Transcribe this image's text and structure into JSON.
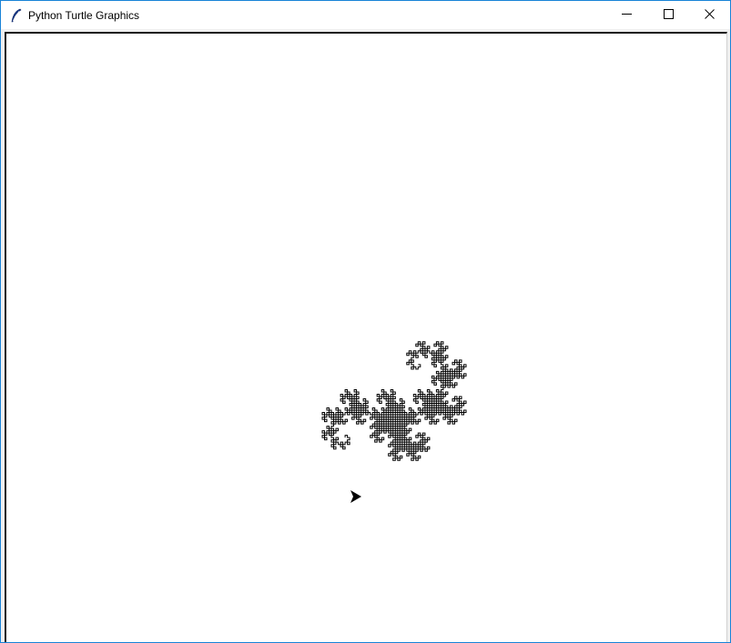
{
  "window": {
    "title": "Python Turtle Graphics",
    "icon": "feather-icon",
    "controls": {
      "minimize": "minimize-icon",
      "maximize": "maximize-icon",
      "close": "close-icon"
    }
  },
  "canvas": {
    "background": "#ffffff",
    "pen_color": "#000000",
    "drawing": "dragon-curve-fractal",
    "turtle_shape": "arrow-cursor-icon"
  }
}
